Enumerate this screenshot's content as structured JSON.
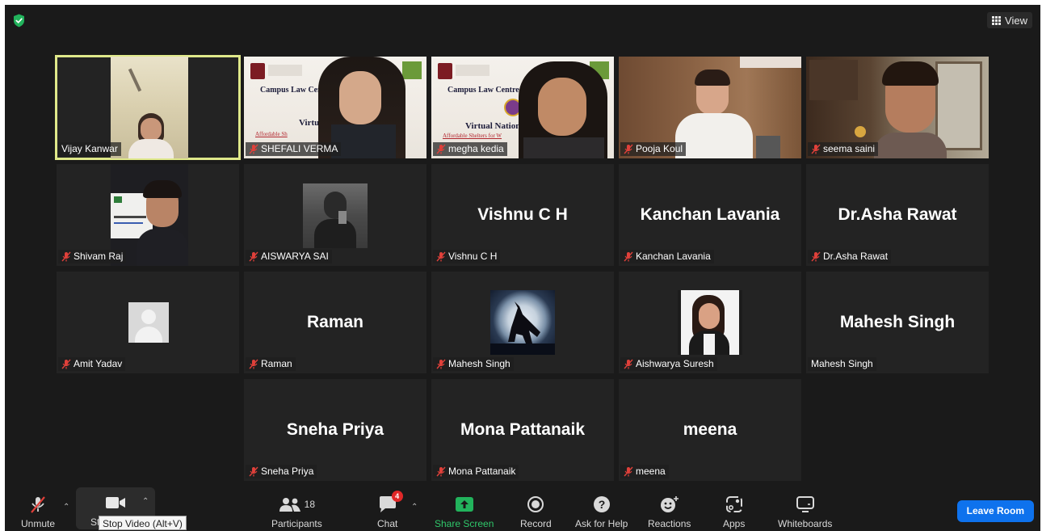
{
  "header": {
    "view_label": "View"
  },
  "tiles": [
    {
      "name": "Vijay Kanwar",
      "muted": false
    },
    {
      "name": "SHEFALI VERMA",
      "muted": true,
      "banner_title": "Campus Law Centr",
      "banner_sub": "Affordable Sh",
      "banner_mid": "Virtu"
    },
    {
      "name": "megha kedia",
      "muted": true,
      "banner_title": "Campus Law Centre, Un",
      "banner_sub": "Affordable Shelters for W",
      "banner_mid": "Virtual Nationa"
    },
    {
      "name": "Pooja Koul",
      "muted": true
    },
    {
      "name": "seema saini",
      "muted": true
    },
    {
      "name": "Shivam Raj",
      "muted": true
    },
    {
      "name": "AISWARYA SAI",
      "muted": true
    },
    {
      "name": "Vishnu C H",
      "muted": true,
      "display": "Vishnu C H"
    },
    {
      "name": "Kanchan Lavania",
      "muted": true,
      "display": "Kanchan Lavania"
    },
    {
      "name": "Dr.Asha Rawat",
      "muted": true,
      "display": "Dr.Asha Rawat"
    },
    {
      "name": "Amit Yadav",
      "muted": true
    },
    {
      "name": "Raman",
      "muted": true,
      "display": "Raman"
    },
    {
      "name": "Mahesh Singh",
      "muted": true
    },
    {
      "name": "Aishwarya Suresh",
      "muted": true
    },
    {
      "name": "Mahesh Singh",
      "muted": false,
      "display": "Mahesh Singh"
    },
    {
      "name": "Sneha Priya",
      "muted": true,
      "display": "Sneha Priya"
    },
    {
      "name": "Mona Pattanaik",
      "muted": true,
      "display": "Mona Pattanaik"
    },
    {
      "name": "meena",
      "muted": true,
      "display": "meena"
    }
  ],
  "toolbar": {
    "unmute": "Unmute",
    "start_video_partial": "St",
    "tooltip": "Stop Video (Alt+V)",
    "participants": "Participants",
    "participants_count": "18",
    "chat": "Chat",
    "chat_badge": "4",
    "share_screen": "Share Screen",
    "record": "Record",
    "ask_for_help": "Ask for Help",
    "reactions": "Reactions",
    "apps": "Apps",
    "whiteboards": "Whiteboards",
    "leave": "Leave Room"
  },
  "colors": {
    "active_speaker": "#dfe88a",
    "share": "#2fc76a",
    "leave": "#0e72ed",
    "mute_red": "#e0403a"
  }
}
